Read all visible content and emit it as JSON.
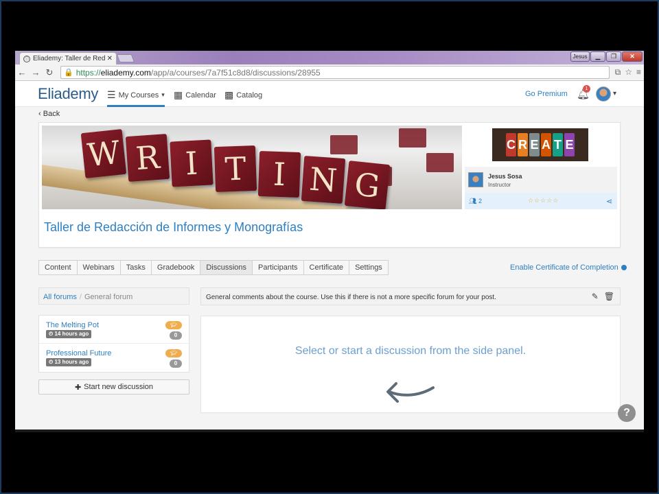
{
  "browser": {
    "tab_title": "Eliademy: Taller de Redacc",
    "user_chip": "Jesus",
    "url_scheme": "https://",
    "url_host": "eliademy.com",
    "url_path": "/app/a/courses/7a7f51c8d8/discussions/28955"
  },
  "header": {
    "logo": "Eliademy",
    "nav": [
      {
        "label": "My Courses",
        "icon": "menu-icon"
      },
      {
        "label": "Calendar",
        "icon": "calendar-icon"
      },
      {
        "label": "Catalog",
        "icon": "catalog-icon"
      }
    ],
    "go_premium": "Go Premium",
    "notification_count": "1"
  },
  "back_label": "Back",
  "course": {
    "banner_letters": [
      "W",
      "R",
      "I",
      "T",
      "I",
      "N",
      "G"
    ],
    "banner_subscripts": [
      "4",
      "1",
      "1",
      "1",
      "1",
      "1",
      "2"
    ],
    "create_letters": [
      "C",
      "R",
      "E",
      "A",
      "T",
      "E"
    ],
    "instructor_name": "Jesus Sosa",
    "instructor_role": "Instructor",
    "participants": "2",
    "title": "Taller de Redacción de Informes y Monografías"
  },
  "tabs": [
    "Content",
    "Webinars",
    "Tasks",
    "Gradebook",
    "Discussions",
    "Participants",
    "Certificate",
    "Settings"
  ],
  "active_tab": "Discussions",
  "enable_certificate": "Enable Certificate of Completion",
  "breadcrumb": {
    "root": "All forums",
    "current": "General forum"
  },
  "forum_description": "General comments about the course. Use this if there is not a more specific forum for your post.",
  "forums": [
    {
      "name": "The Melting Pot",
      "time": "14 hours ago",
      "count": "0"
    },
    {
      "name": "Professional Future",
      "time": "13 hours ago",
      "count": "0"
    }
  ],
  "start_discussion": "Start new discussion",
  "empty_message": "Select or start a discussion from the side panel.",
  "colors": {
    "accent": "#2d7fc1",
    "badge_orange": "#f0ad4e",
    "notification_red": "#d9534f"
  }
}
